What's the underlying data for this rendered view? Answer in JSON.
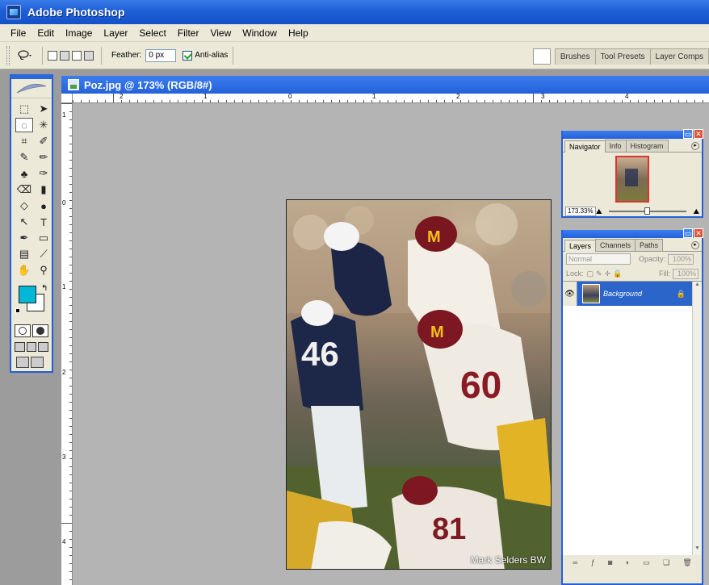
{
  "app": {
    "title": "Adobe Photoshop"
  },
  "menu": [
    "File",
    "Edit",
    "Image",
    "Layer",
    "Select",
    "Filter",
    "View",
    "Window",
    "Help"
  ],
  "options": {
    "feather_label": "Feather:",
    "feather_value": "0 px",
    "antialias_label": "Anti-alias"
  },
  "palette_well": {
    "tabs": [
      "Brushes",
      "Tool Presets",
      "Layer Comps"
    ]
  },
  "colors": {
    "foreground": "#00b7d6",
    "background": "#ffffff",
    "title_blue": "#2461d8"
  },
  "document": {
    "title": "Poz.jpg @ 173% (RGB/8#)",
    "ruler_h": [
      "2",
      "1",
      "0",
      "1",
      "2",
      "3",
      "4"
    ],
    "ruler_v": [
      "1",
      "0",
      "1",
      "2",
      "3",
      "4"
    ],
    "watermark": "Mark Selders BW"
  },
  "navigator": {
    "tabs": [
      "Navigator",
      "Info",
      "Histogram"
    ],
    "zoom": "173.33%"
  },
  "layers": {
    "tabs": [
      "Layers",
      "Channels",
      "Paths"
    ],
    "blend_mode": "Normal",
    "opacity_label": "Opacity:",
    "opacity": "100%",
    "lock_label": "Lock:",
    "fill_label": "Fill:",
    "fill": "100%",
    "items": [
      {
        "name": "Background"
      }
    ]
  }
}
